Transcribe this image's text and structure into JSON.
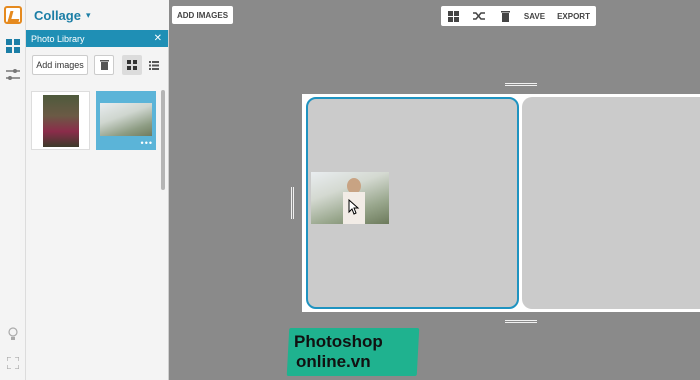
{
  "app": {
    "title": "Collage"
  },
  "panel": {
    "title": "Photo Library",
    "add_images_label": "Add images"
  },
  "toolbar": {
    "add_images_label": "ADD IMAGES",
    "save_label": "SAVE",
    "export_label": "EXPORT"
  },
  "watermark": {
    "line1": "Photoshop",
    "line2": "online.vn"
  },
  "colors": {
    "accent": "#1f8fb5",
    "logo": "#e58a1f",
    "canvas_bg": "#8a8a8a",
    "cell_bg": "#cbcbcb",
    "watermark_bg": "#1fb28f"
  },
  "icons": {
    "rail": [
      "app-logo-icon",
      "layout-grid-icon",
      "adjust-sliders-icon",
      "lightbulb-icon",
      "fullscreen-icon"
    ],
    "toolbar": [
      "grid-layout-icon",
      "shuffle-icon",
      "trash-icon"
    ]
  }
}
